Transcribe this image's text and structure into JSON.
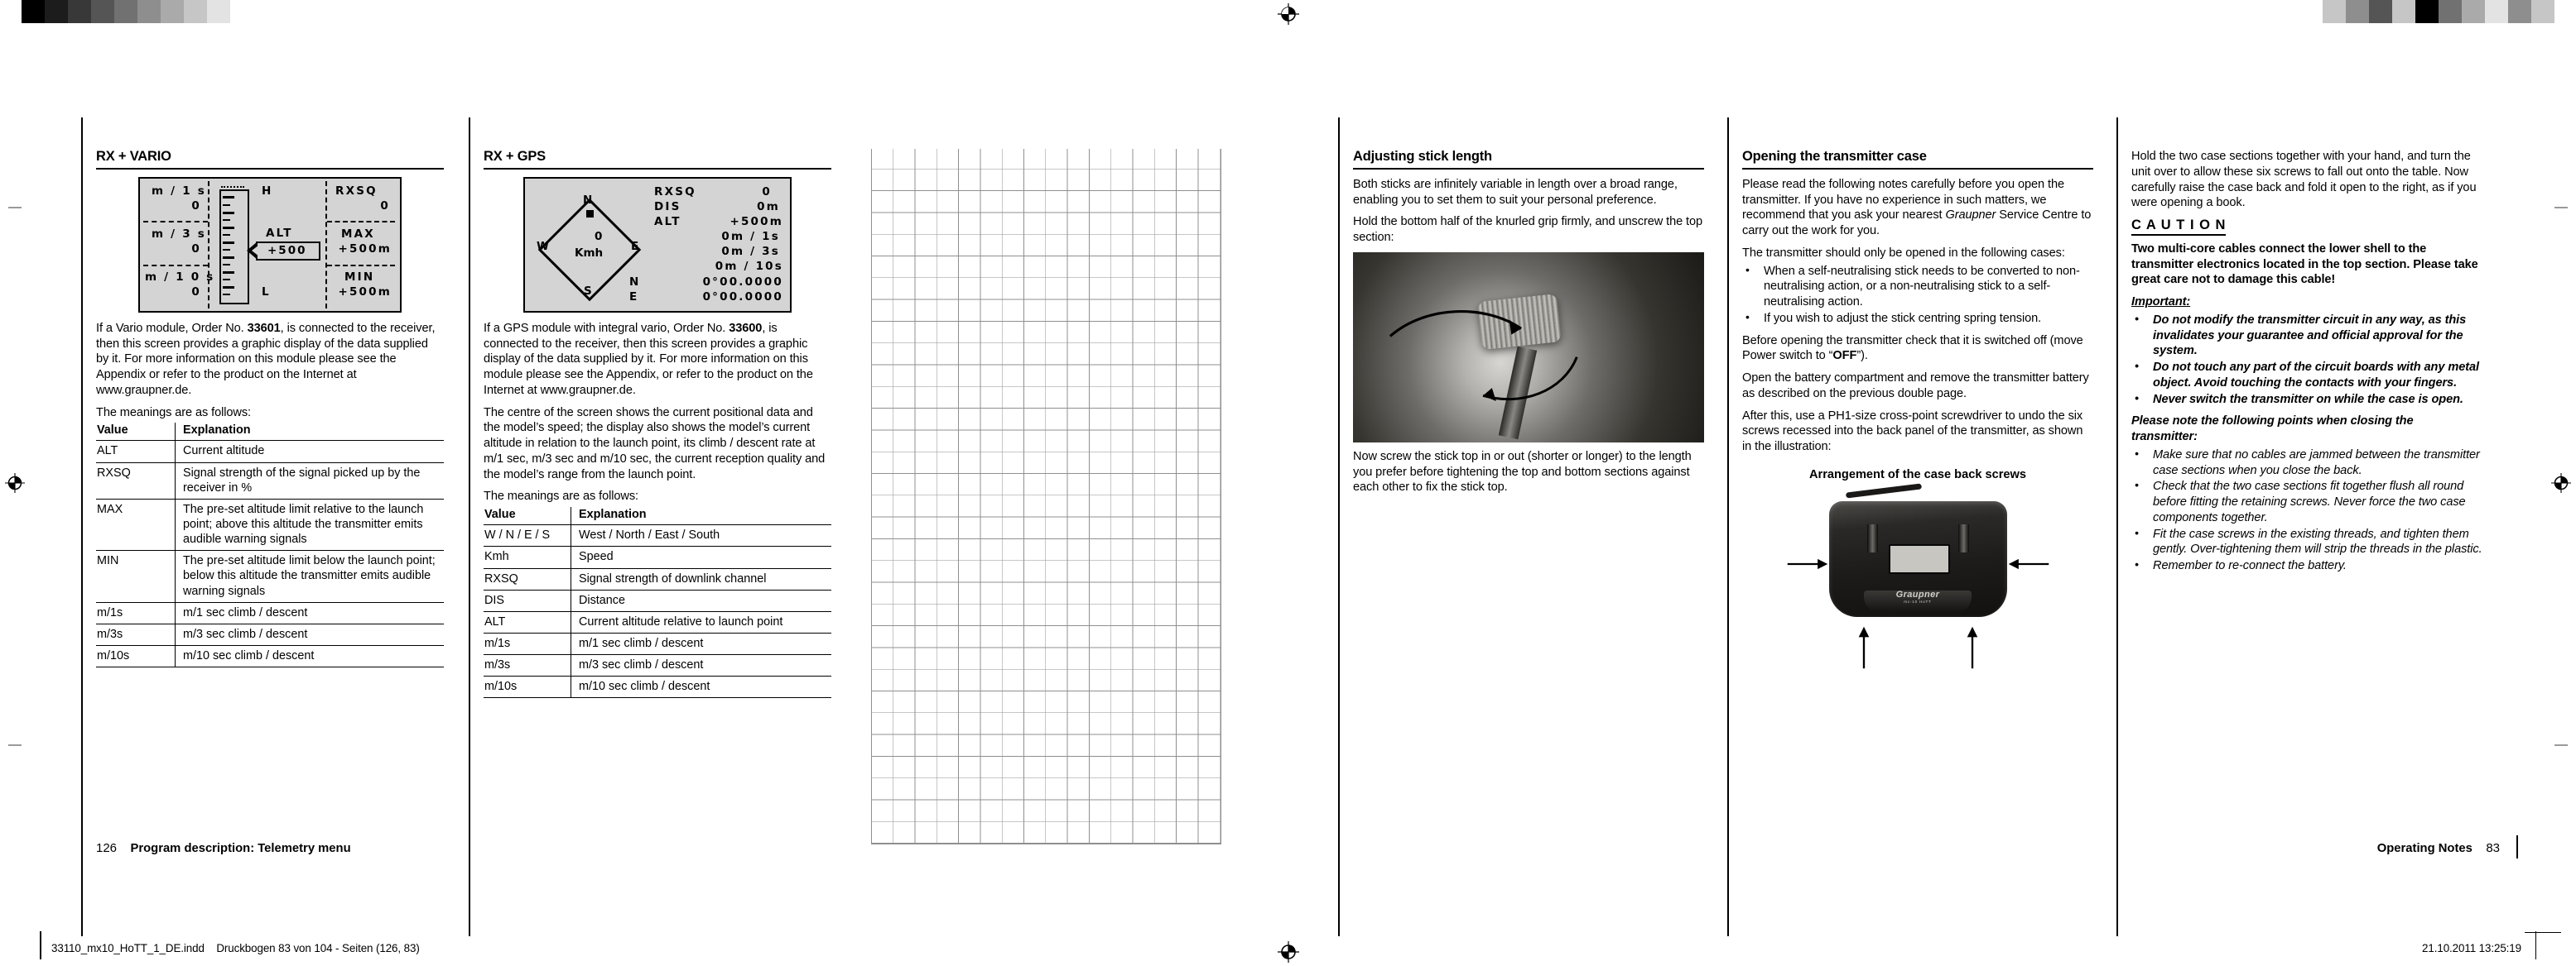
{
  "meta": {
    "print_filename": "33110_mx10_HoTT_1_DE.indd",
    "print_sheet": "Druckbogen 83 von 104 - Seiten (126, 83)",
    "print_timestamp": "21.10.2011   13:25:19"
  },
  "page_left": {
    "page_number": "126",
    "footer_title": "Program description: Telemetry menu",
    "col1": {
      "heading": "RX + VARIO",
      "lcd": {
        "left_cells": [
          {
            "label": "m / 1 s",
            "value": "0"
          },
          {
            "label": "m / 3 s",
            "value": "0"
          },
          {
            "label": "m / 1 0 s",
            "value": "0"
          }
        ],
        "bar_top_label": "H",
        "bar_bottom_label": "L",
        "alt_label": "ALT",
        "alt_value": "+500",
        "right_cells": [
          {
            "label": "RXSQ",
            "value": "0"
          },
          {
            "label": "MAX",
            "value": "+500m"
          },
          {
            "label": "MIN",
            "value": "+500m"
          }
        ]
      },
      "para1_a": "If a Vario module, Order No. ",
      "para1_b": "33601",
      "para1_c": ", is connected to the receiver, then this screen provides a graphic display of the data supplied by it. For more information on this module please see the Appendix or refer to the product on the Internet at www.graupner.de.",
      "para2": "The meanings are as follows:",
      "table": {
        "headers": [
          "Value",
          "Explanation"
        ],
        "rows": [
          [
            "ALT",
            "Current altitude"
          ],
          [
            "RXSQ",
            "Signal strength of the signal picked up by the receiver in %"
          ],
          [
            "MAX",
            "The pre-set altitude limit relative to the launch point; above this altitude the transmitter emits audible warning signals"
          ],
          [
            "MIN",
            "The pre-set altitude limit below the launch point; below this altitude the transmitter emits audible warning signals"
          ],
          [
            "m/1s",
            "m/1 sec climb / descent"
          ],
          [
            "m/3s",
            "m/3 sec climb / descent"
          ],
          [
            "m/10s",
            "m/10 sec climb / descent"
          ]
        ]
      }
    },
    "col2": {
      "heading": "RX + GPS",
      "lcd": {
        "compass": {
          "north": "N",
          "south": "S",
          "west": "W",
          "east": "E",
          "speed": "0",
          "speed_unit": "Kmh"
        },
        "rows": [
          {
            "label": "RXSQ",
            "value": "0"
          },
          {
            "label": "DIS",
            "value": "0m"
          },
          {
            "label": "ALT",
            "value": "+500m"
          },
          {
            "label": "",
            "value": "0m / 1s"
          },
          {
            "label": "",
            "value": "0m / 3s"
          },
          {
            "label": "",
            "value": "0m / 10s"
          },
          {
            "label": "N",
            "value": "0°00.0000"
          },
          {
            "label": "E",
            "value": "0°00.0000"
          }
        ]
      },
      "para1_a": "If a GPS module with integral vario, Order No. ",
      "para1_b": "33600",
      "para1_c": ", is connected to the receiver, then this screen provides a graphic display of the data supplied by it. For more information on this module please see the Appendix, or refer to the product on the Internet at www.graupner.de.",
      "para2": "The centre of the screen shows the current positional data and the model’s speed; the display also shows the model’s current altitude in relation to the launch point, its climb / descent rate at m/1 sec, m/3 sec and m/10 sec, the current reception quality and the model’s range from the launch point.",
      "para3": "The meanings are as follows:",
      "table": {
        "headers": [
          "Value",
          "Explanation"
        ],
        "rows": [
          [
            "W / N / E / S",
            "West / North / East / South"
          ],
          [
            "Kmh",
            "Speed"
          ],
          [
            "RXSQ",
            "Signal strength of downlink channel"
          ],
          [
            "DIS",
            "Distance"
          ],
          [
            "ALT",
            "Current altitude relative to launch point"
          ],
          [
            "m/1s",
            "m/1 sec climb / descent"
          ],
          [
            "m/3s",
            "m/3 sec climb / descent"
          ],
          [
            "m/10s",
            "m/10 sec climb / descent"
          ]
        ]
      }
    }
  },
  "page_right": {
    "page_number": "83",
    "footer_title": "Operating Notes",
    "col1": {
      "heading": "Adjusting stick length",
      "para1": "Both sticks are infinitely variable in length over a broad range, enabling you to set them to suit your personal preference.",
      "para2": "Hold the bottom half of the knurled grip firmly, and unscrew the top section:",
      "para3": "Now screw the stick top in or out (shorter or longer) to the length you prefer before tightening the top and bottom sections against each other to fix the stick top."
    },
    "col2": {
      "heading": "Opening the transmitter case",
      "para1_a": "Please read the following notes carefully before you open the transmitter. If you have no experience in such matters, we recommend that you ask your nearest ",
      "para1_b": "Graupner",
      "para1_c": " Service Centre to carry out the work for you.",
      "para2": "The transmitter should only be opened in the following cases:",
      "bullets": [
        "When a self-neutralising stick needs to be converted to non-neutralising action, or a non-neutralising stick to a self-neutralising action.",
        "If you wish to adjust the stick centring spring tension."
      ],
      "para3_a": "Before opening the transmitter check that it is switched off (move Power switch to “",
      "para3_b": "OFF",
      "para3_c": "”).",
      "para4": "Open the battery compartment and remove the transmitter battery as described on the previous double page.",
      "para5": "After this, use a PH1-size cross-point screwdriver to undo the six screws recessed into the back panel of the transmitter, as shown in the illustration:",
      "figure_caption": "Arrangement of the case back screws"
    },
    "col3": {
      "para1": "Hold the two case sections together with your hand, and turn the unit over to allow these six screws to fall out onto the table. Now carefully raise the case back and fold it open to the right, as if you were opening a book.",
      "caution_heading": "C A U T I O N",
      "caution_body": "Two multi-core cables connect the lower shell to the transmitter electronics located in the top section. Please take great care not to damage this cable!",
      "important_heading": "Important:",
      "important_bullets": [
        "Do not modify the transmitter circuit in any way, as this invalidates your guarantee and official approval for the system.",
        "Do not touch any part of the circuit boards with any metal object. Avoid touching the contacts with your fingers.",
        "Never switch the transmitter on while the case is open."
      ],
      "closing_heading": "Please note the following points when closing the transmitter:",
      "closing_bullets": [
        "Make sure that no cables are jammed between the transmitter case sections when you close the back.",
        "Check that the two case sections fit together flush all round before fitting the retaining screws. Never force the two case components together.",
        "Fit the case screws in the existing threads, and tighten them gently. Over-tightening them will strip the threads in the plastic.",
        "Remember to re-connect the battery."
      ]
    }
  },
  "calibration": {
    "left_swatches": [
      "#000000",
      "#1c1c1c",
      "#383838",
      "#555555",
      "#717171",
      "#8e8e8e",
      "#aaaaaa",
      "#c6c6c6",
      "#e3e3e3",
      "#ffffff"
    ],
    "right_swatches": [
      "#c6c6c6",
      "#8e8e8e",
      "#555555",
      "#c6c6c6",
      "#000000",
      "#717171",
      "#aaaaaa",
      "#e3e3e3",
      "#8e8e8e",
      "#c6c6c6"
    ]
  }
}
